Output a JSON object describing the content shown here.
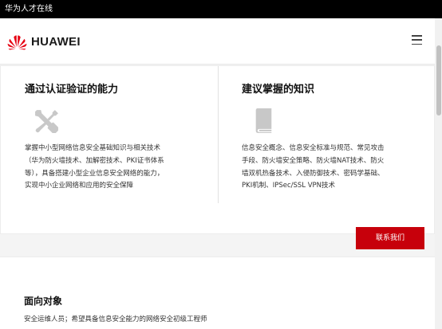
{
  "window": {
    "title": "华为人才在线"
  },
  "header": {
    "brand": "HUAWEI"
  },
  "card": {
    "left": {
      "title": "通过认证验证的能力",
      "icon": "tools-icon",
      "lines": [
        "掌握中小型网络信息安全基础知识与相关技术",
        "（华为防火墙技术、加解密技术、PKI证书体系",
        "等），具备搭建小型企业信息安全网络的能力，",
        "实现中小企业网络和应用的安全保障"
      ]
    },
    "right": {
      "title": "建议掌握的知识",
      "icon": "book-icon",
      "lines": [
        "信息安全概念、信息安全标准与规范、常见攻击",
        "手段、防火墙安全策略、防火墙NAT技术、防火",
        "墙双机热备技术、入侵防御技术、密码学基础、",
        "PKI机制、IPSec/SSL VPN技术"
      ]
    },
    "contact_label": "联系我们"
  },
  "audience": {
    "title": "面向对象",
    "text": "安全运维人员；希望具备信息安全能力的网络安全初级工程师"
  },
  "colors": {
    "accent": "#c7000b",
    "logo_red": "#e60012"
  }
}
